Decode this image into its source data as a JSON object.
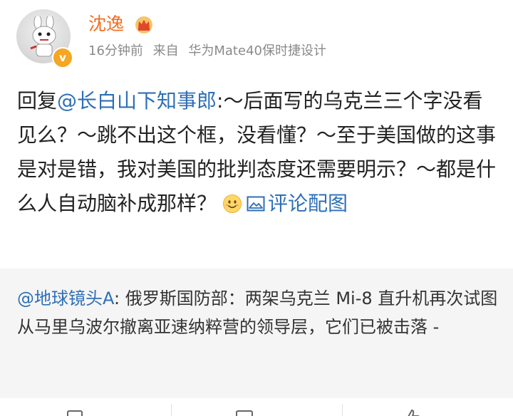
{
  "user": {
    "name": "沈逸",
    "verified_badge": "v",
    "badge_color": "#f5a623",
    "name_color": "#f26d1f"
  },
  "meta": {
    "time": "16分钟前",
    "source_prefix": "来自",
    "device": "华为Mate40保时捷设计"
  },
  "post": {
    "reply_prefix": "回复",
    "mention": "@长白山下知事郎",
    "text": ":～后面写的乌克兰三个字没看见么？～跳不出这个框，没看懂？～至于美国做的这事是对是错，我对美国的批判态度还需要明示？～都是什么人自动脑补成那样？",
    "pic_link": "评论配图",
    "emoji": "smile-emoji"
  },
  "quote": {
    "mention": "@地球镜头A",
    "text": ": 俄罗斯国防部：两架乌克兰 Mi-8 直升机再次试图从马里乌波尔撤离亚速纳粹营的领导层，它们已被击落 -"
  },
  "colors": {
    "link": "#2e6fb7",
    "quote_bg": "#f5f5f5",
    "meta_text": "#8a8a8a"
  }
}
